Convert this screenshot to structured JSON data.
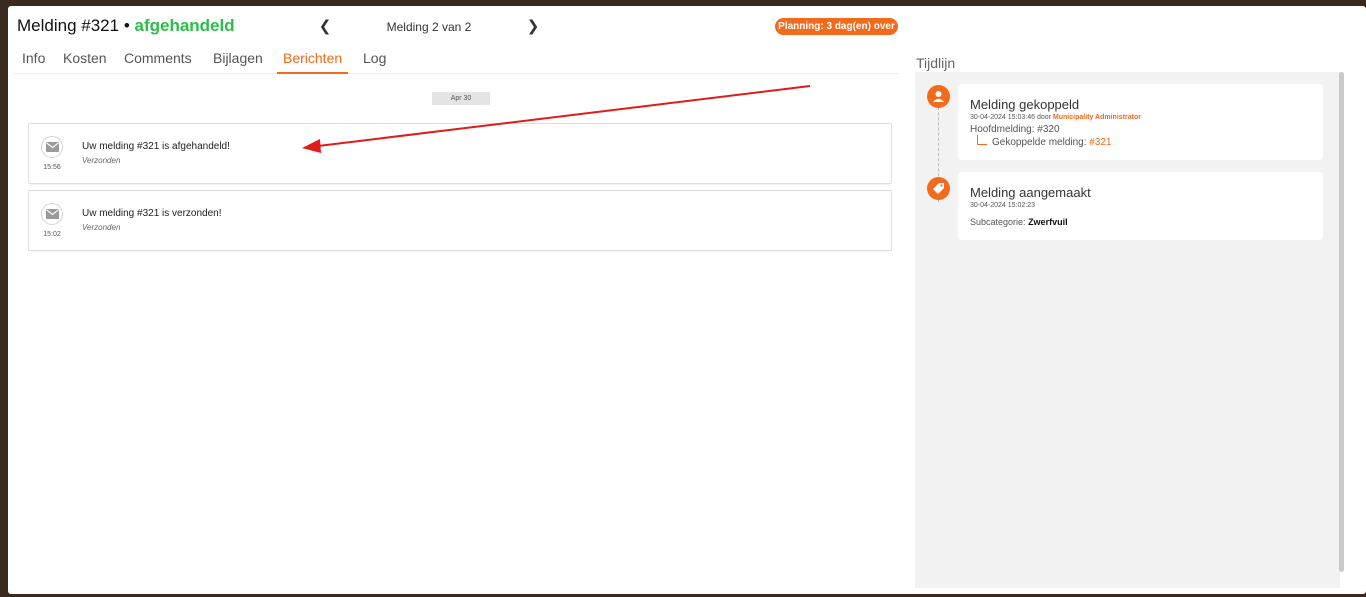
{
  "header": {
    "title": "Melding #321",
    "separator": "•",
    "status": "afgehandeld",
    "nav_prev_icon": "chevron-left-icon",
    "nav_next_icon": "chevron-right-icon",
    "nav_count": "Melding 2 van 2",
    "planning_badge": "Planning: 3 dag(en) over"
  },
  "tabs": [
    {
      "label": "Info"
    },
    {
      "label": "Kosten"
    },
    {
      "label": "Comments"
    },
    {
      "label": "Bijlagen"
    },
    {
      "label": "Berichten",
      "active": true
    },
    {
      "label": "Log"
    }
  ],
  "messages": {
    "date_label": "Apr 30",
    "items": [
      {
        "time": "15:56",
        "text": "Uw melding #321 is afgehandeld!",
        "status": "Verzonden"
      },
      {
        "time": "15:02",
        "text": "Uw melding #321 is verzonden!",
        "status": "Verzonden"
      }
    ]
  },
  "timeline": {
    "title": "Tijdlijn",
    "events": [
      {
        "icon": "user-link-icon",
        "title": "Melding gekoppeld",
        "timestamp": "30-04-2024 15:03:46 door",
        "author": "Municipality Administrator",
        "main_label": "Hoofdmelding: #320",
        "linked_label": "Gekoppelde melding:",
        "linked_value": "#321"
      },
      {
        "icon": "tag-icon",
        "title": "Melding aangemaakt",
        "timestamp": "30-04-2024 15:02:23",
        "subcategory_label": "Subcategorie:",
        "subcategory_value": "Zwerfvuil"
      }
    ]
  },
  "colors": {
    "accent": "#f26a1b",
    "status_done": "#2dbe4a",
    "annotation_arrow": "#e01b1b"
  }
}
